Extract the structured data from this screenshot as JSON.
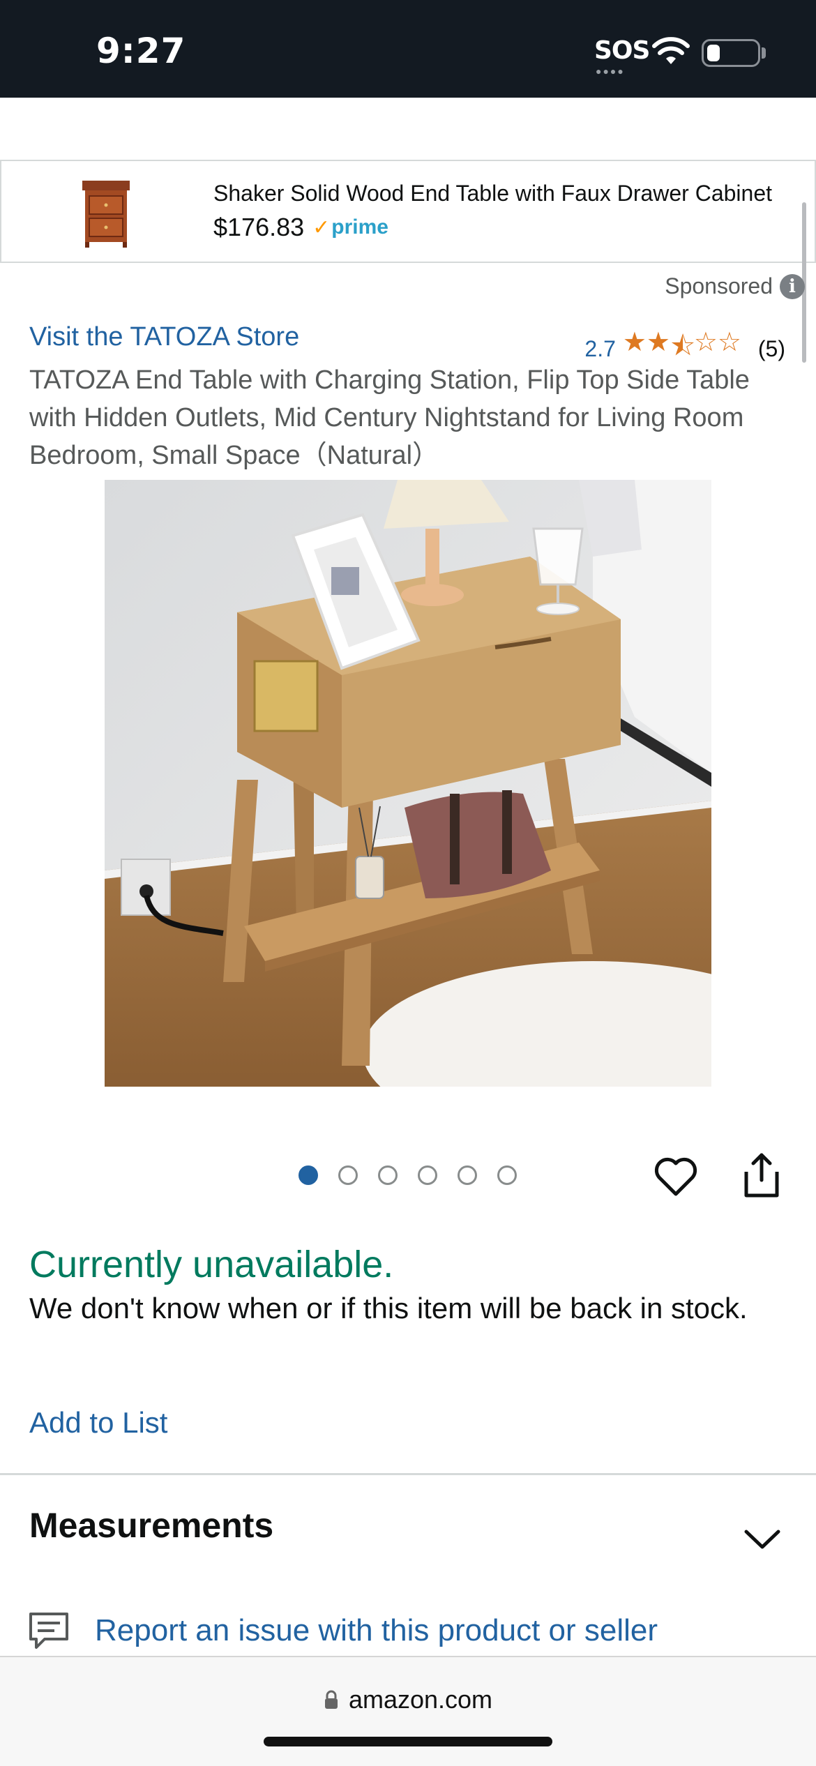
{
  "status_bar": {
    "time": "9:27",
    "sos_label": "SOS",
    "wifi_icon": "wifi-icon",
    "battery_icon": "battery-icon",
    "battery_level_fraction": 0.25
  },
  "ad_banner": {
    "title": "Shaker Solid Wood End Table with Faux Drawer Cabinet",
    "price": "$176.83",
    "prime_label": "prime",
    "prime_check": "✓",
    "thumbnail_icon": "end-table-thumbnail"
  },
  "sponsored": {
    "label": "Sponsored",
    "info_glyph": "i"
  },
  "product": {
    "store_link": "Visit the TATOZA Store",
    "rating_value": "2.7",
    "rating_stars_fraction": 0.54,
    "rating_count": "(5)",
    "title": "TATOZA End Table with Charging Station, Flip Top Side Table with Hidden Outlets, Mid Century Nightstand for Living Room Bedroom, Small Space（Natural）",
    "image_icon": "product-photo-nightstand",
    "image_count": 6,
    "active_image_index": 0
  },
  "availability": {
    "status": "Currently unavailable.",
    "detail": "We don't know when or if this item will be back in stock."
  },
  "actions": {
    "add_to_list": "Add to List",
    "heart_icon": "heart-icon",
    "share_icon": "share-icon"
  },
  "sections": {
    "measurements": "Measurements",
    "report": "Report an issue with this product or seller"
  },
  "browser": {
    "url": "amazon.com",
    "lock_icon": "lock-icon"
  },
  "colors": {
    "link_blue": "#2162a1",
    "available_green": "#007a5e",
    "star_orange": "#de7921",
    "prime_blue": "#2ba0c9",
    "status_bar_bg": "#131a22"
  }
}
